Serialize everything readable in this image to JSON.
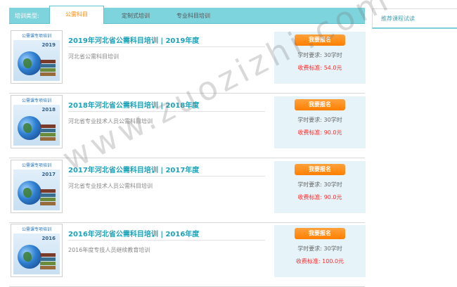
{
  "filter": {
    "label": "培训类型:",
    "tabs": [
      {
        "label": "公需科目",
        "active": true
      },
      {
        "label": "定制式培训",
        "active": false
      },
      {
        "label": "专业科目培训",
        "active": false
      }
    ]
  },
  "sidebar": {
    "title": "推荐课程试读"
  },
  "courses": [
    {
      "thumb_banner": "公需课专项培训",
      "thumb_year": "2019",
      "title": "2019年河北省公需科目培训 | 2019年度",
      "description": "河北省公需科目培训",
      "enroll_label": "我要报名",
      "hours": "学时要求: 30学时",
      "fee": "收费标准: 54.0元"
    },
    {
      "thumb_banner": "公需课专项培训",
      "thumb_year": "2018",
      "title": "2018年河北省公需科目培训 | 2018年度",
      "description": "河北省专业技术人员公需科目培训",
      "enroll_label": "我要报名",
      "hours": "学时要求: 30学时",
      "fee": "收费标准: 90.0元"
    },
    {
      "thumb_banner": "公需课专项培训",
      "thumb_year": "2017",
      "title": "2017年河北省公需科目培训 | 2017年度",
      "description": "河北省专业技术人员公需科目培训",
      "enroll_label": "我要报名",
      "hours": "学时要求: 30学时",
      "fee": "收费标准: 90.0元"
    },
    {
      "thumb_banner": "公需课专项培训",
      "thumb_year": "2016",
      "title": "2016年河北省公需科目培训 | 2016年度",
      "description": "2016年度专技人员继续教育培训",
      "enroll_label": "我要报名",
      "hours": "学时要求: 30学时",
      "fee": "收费标准: 100.0元"
    }
  ],
  "watermark": "www.zuozizhi.com",
  "colors": {
    "tabbar": "#7dd4dd",
    "active_tab_text": "#ff8a00",
    "title": "#1aa3b8",
    "fee": "#ff2a2a",
    "enroll_button": "#ff8a00"
  }
}
